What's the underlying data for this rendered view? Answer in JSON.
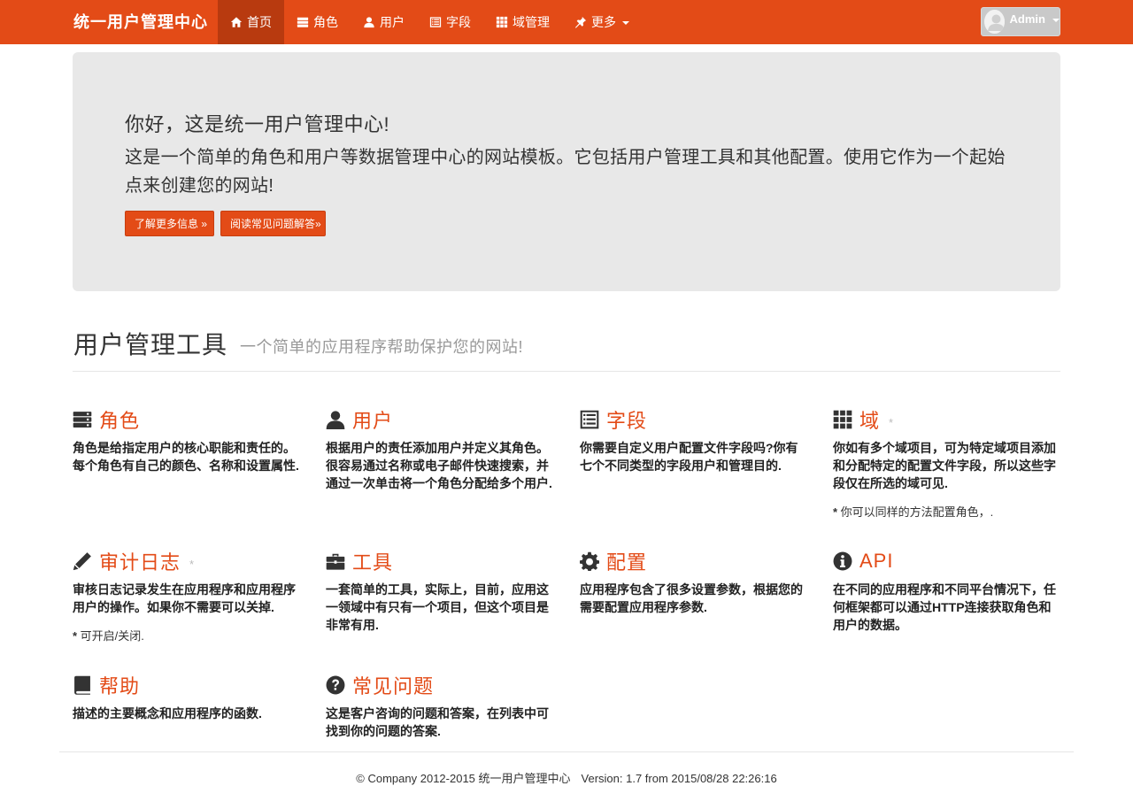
{
  "nav": {
    "brand": "统一用户管理中心",
    "items": [
      {
        "label": "首页",
        "icon": "home-icon",
        "active": true
      },
      {
        "label": "角色",
        "icon": "server-icon"
      },
      {
        "label": "用户",
        "icon": "user-icon"
      },
      {
        "label": "字段",
        "icon": "list-alt-icon"
      },
      {
        "label": "域管理",
        "icon": "grid-icon"
      },
      {
        "label": "更多",
        "icon": "pushpin-icon"
      }
    ],
    "user": "Admin"
  },
  "hero": {
    "title": "你好，这是统一用户管理中心!",
    "lead": "这是一个简单的角色和用户等数据管理中心的网站模板。它包括用户管理工具和其他配置。使用它作为一个起始点来创建您的网站!",
    "btn_more": "了解更多信息 »",
    "btn_faq": "阅读常见问题解答»"
  },
  "section": {
    "title": "用户管理工具",
    "subtitle": "一个简单的应用程序帮助保护您的网站!"
  },
  "features": [
    {
      "icon": "server-icon",
      "title": "角色",
      "star": "",
      "desc": "角色是给指定用户的核心职能和责任的。每个角色有自己的颜色、名称和设置属性.",
      "note": ""
    },
    {
      "icon": "user-icon",
      "title": "用户",
      "star": "",
      "desc": "根据用户的责任添加用户并定义其角色。很容易通过名称或电子邮件快速搜索，并通过一次单击将一个角色分配给多个用户.",
      "note": ""
    },
    {
      "icon": "list-alt-icon",
      "title": "字段",
      "star": "",
      "desc": "你需要自定义用户配置文件字段吗?你有七个不同类型的字段用户和管理目的.",
      "note": ""
    },
    {
      "icon": "grid-icon",
      "title": "域",
      "star": "*",
      "desc": "你如有多个域项目，可为特定域项目添加和分配特定的配置文件字段，所以这些字段仅在所选的域可见.",
      "note": "你可以同样的方法配置角色，."
    },
    {
      "icon": "pencil-icon",
      "title": "审计日志",
      "star": "*",
      "desc": "审核日志记录发生在应用程序和应用程序用户的操作。如果你不需要可以关掉.",
      "note": "可开启/关闭."
    },
    {
      "icon": "briefcase-icon",
      "title": "工具",
      "star": "",
      "desc": "一套简单的工具，实际上，目前，应用这一领域中有只有一个项目，但这个项目是非常有用.",
      "note": ""
    },
    {
      "icon": "cog-icon",
      "title": "配置",
      "star": "",
      "desc": "应用程序包含了很多设置参数，根据您的需要配置应用程序参数.",
      "note": ""
    },
    {
      "icon": "info-icon",
      "title": "API",
      "star": "",
      "desc": "在不同的应用程序和不同平台情况下，任何框架都可以通过HTTP连接获取角色和用户的数据。",
      "note": ""
    },
    {
      "icon": "book-icon",
      "title": "帮助",
      "star": "",
      "desc": "描述的主要概念和应用程序的函数.",
      "note": ""
    },
    {
      "icon": "question-icon",
      "title": "常见问题",
      "star": "",
      "desc": "这是客户咨询的问题和答案，在列表中可找到你的问题的答案.",
      "note": ""
    }
  ],
  "footer": {
    "copyright": "© Company 2012-2015 统一用户管理中心",
    "version": "Version: 1.7 from 2015/08/28 22:26:16"
  },
  "colors": {
    "accent": "#e34b17",
    "active_nav": "#b83a0f",
    "hero_bg": "#e8e8e8"
  }
}
